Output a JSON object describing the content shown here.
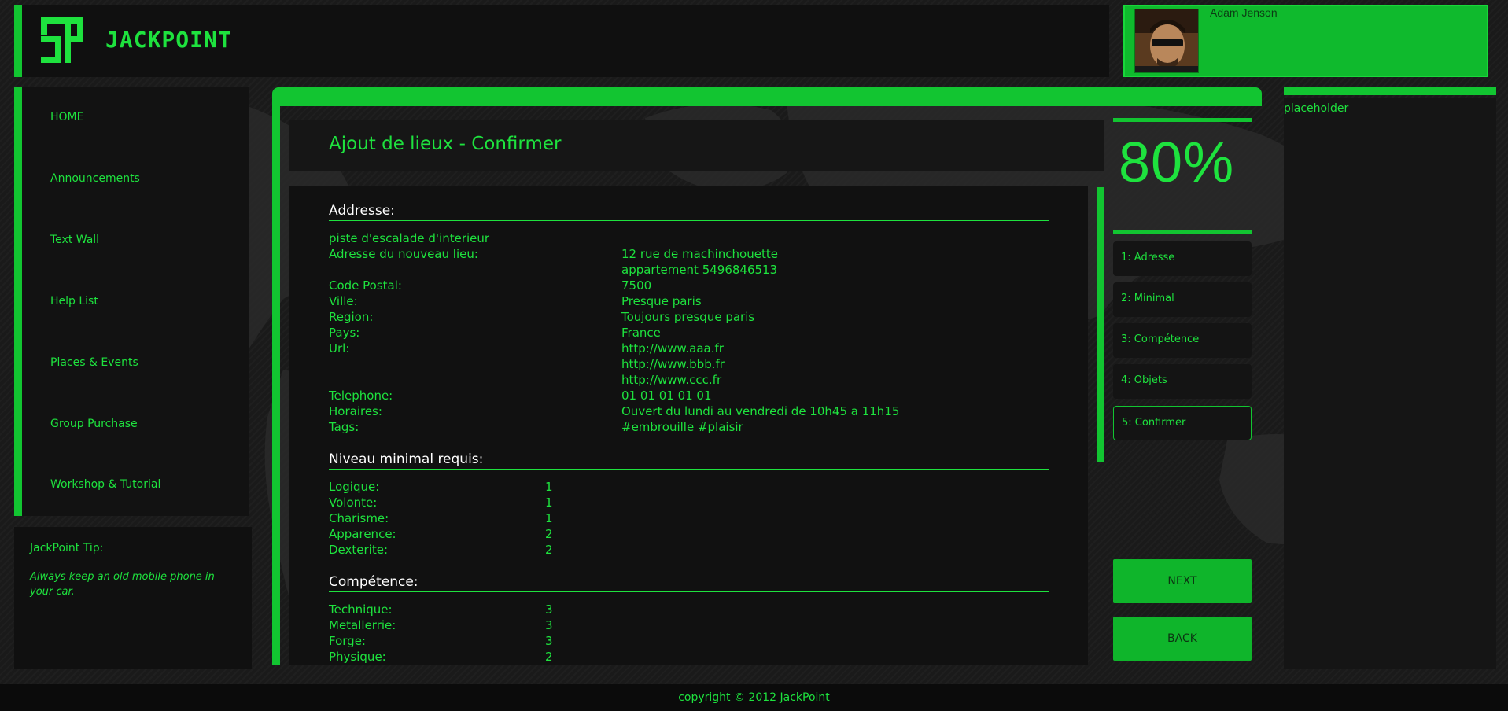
{
  "header": {
    "logo_text": "JACKPOINT",
    "user_name": "Adam Jenson"
  },
  "sidebar": {
    "items": [
      {
        "label": "HOME"
      },
      {
        "label": "Announcements"
      },
      {
        "label": "Text Wall"
      },
      {
        "label": "Help List"
      },
      {
        "label": "Places & Events"
      },
      {
        "label": "Group Purchase"
      },
      {
        "label": "Workshop & Tutorial"
      }
    ],
    "tip_title": "JackPoint Tip:",
    "tip_body": "Always keep an old mobile phone in your car."
  },
  "main": {
    "title": "Ajout de lieux - Confirmer",
    "address": {
      "section_title": "Addresse:",
      "place_name": "piste d'escalade d'interieur",
      "rows": [
        {
          "label": "Adresse du nouveau lieu:",
          "value": "12 rue de machinchouette"
        },
        {
          "label": "",
          "value": "appartement 5496846513"
        },
        {
          "label": "Code Postal:",
          "value": "7500"
        },
        {
          "label": "Ville:",
          "value": "Presque paris"
        },
        {
          "label": "Region:",
          "value": "Toujours presque paris"
        },
        {
          "label": "Pays:",
          "value": "France"
        },
        {
          "label": "Url:",
          "value": "http://www.aaa.fr"
        },
        {
          "label": "",
          "value": "http://www.bbb.fr"
        },
        {
          "label": "",
          "value": "http://www.ccc.fr"
        },
        {
          "label": "Telephone:",
          "value": "01 01 01 01 01"
        },
        {
          "label": "Horaires:",
          "value": "Ouvert du lundi au vendredi de 10h45 a 11h15"
        },
        {
          "label": "Tags:",
          "value": "#embrouille #plaisir"
        }
      ]
    },
    "niveau": {
      "section_title": "Niveau minimal requis:",
      "rows": [
        {
          "label": "Logique:",
          "value": "1"
        },
        {
          "label": "Volonte:",
          "value": "1"
        },
        {
          "label": "Charisme:",
          "value": "1"
        },
        {
          "label": "Apparence:",
          "value": "2"
        },
        {
          "label": "Dexterite:",
          "value": "2"
        }
      ]
    },
    "competence": {
      "section_title": "Compétence:",
      "rows": [
        {
          "label": "Technique:",
          "value": "3"
        },
        {
          "label": "Metallerrie:",
          "value": "3"
        },
        {
          "label": "Forge:",
          "value": "3"
        },
        {
          "label": "Physique:",
          "value": "2"
        }
      ]
    }
  },
  "progress": {
    "percent_label": "80%",
    "value": 0.8,
    "steps": [
      {
        "label": "1: Adresse"
      },
      {
        "label": "2: Minimal"
      },
      {
        "label": "3: Compétence"
      },
      {
        "label": "4: Objets"
      },
      {
        "label": "5: Confirmer"
      }
    ],
    "next_label": "NEXT",
    "back_label": "BACK"
  },
  "right_column": {
    "placeholder": "placeholder"
  },
  "footer": {
    "copyright": "copyright © 2012 JackPoint"
  },
  "colors": {
    "accent": "#12c531",
    "text_green": "#1ee23e",
    "background": "#1a1a1a",
    "panel": "#111111"
  }
}
